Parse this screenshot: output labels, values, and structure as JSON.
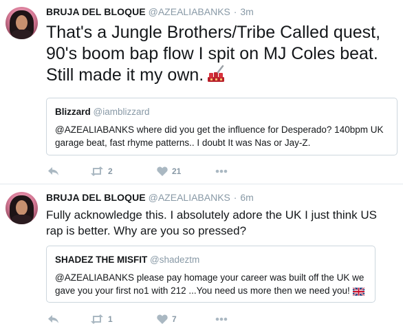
{
  "tweets": [
    {
      "author_name": "BRUJA DEL BLOQUE",
      "author_handle": "@AZEALIABANKS",
      "separator": "·",
      "time": "3m",
      "text": "That's a Jungle Brothers/Tribe Called quest, 90's boom bap flow I spit on MJ Coles beat. Still made it my own.",
      "emoji": "nail-polish-emoji",
      "quote": {
        "name": "Blizzard",
        "handle": "@iamblizzard",
        "text": "@AZEALIABANKS where did you get the influence for Desperado? 140bpm UK garage beat, fast rhyme patterns.. I doubt It was Nas or Jay-Z."
      },
      "retweets": "2",
      "likes": "21"
    },
    {
      "author_name": "BRUJA DEL BLOQUE",
      "author_handle": "@AZEALIABANKS",
      "separator": "·",
      "time": "6m",
      "text": "Fully acknowledge this. I absolutely adore the UK I just think US rap is better. Why are you so pressed?",
      "quote": {
        "name": "SHADEZ THE MISFIT",
        "handle": "@shadeztm",
        "text": "@AZEALIABANKS please pay homage your career was built off the UK we gave you your first no1 with 212 ...You need us more then we need you!",
        "emoji": "uk-flag-emoji"
      },
      "retweets": "1",
      "likes": "7"
    }
  ],
  "colors": {
    "text": "#14171a",
    "muted": "#8899a6",
    "border": "#ccd6dd",
    "icon": "#aab8c2"
  }
}
